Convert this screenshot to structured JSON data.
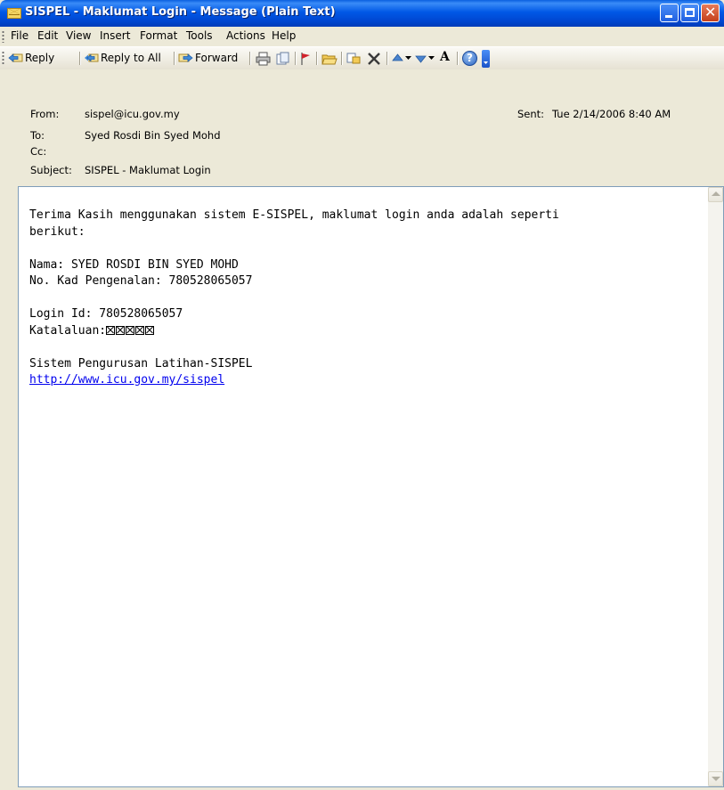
{
  "window": {
    "title": "SISPEL - Maklumat Login - Message (Plain Text)"
  },
  "menu": {
    "items": [
      "File",
      "Edit",
      "View",
      "Insert",
      "Format",
      "Tools",
      "Actions",
      "Help"
    ]
  },
  "toolbar": {
    "reply_label": "Reply",
    "reply_all_label": "Reply to All",
    "forward_label": "Forward",
    "font_size_glyph": "A",
    "help_glyph": "?"
  },
  "header": {
    "from_label": "From:",
    "from_value": "sispel@icu.gov.my",
    "sent_label": "Sent:",
    "sent_value": "Tue 2/14/2006 8:40 AM",
    "to_label": "To:",
    "to_value": "Syed Rosdi Bin Syed Mohd",
    "cc_label": "Cc:",
    "cc_value": "",
    "subject_label": "Subject:",
    "subject_value": "SISPEL - Maklumat Login"
  },
  "body": {
    "line1": "Terima Kasih menggunakan sistem E-SISPEL, maklumat login anda adalah seperti",
    "line2": "berikut:",
    "nama": "Nama: SYED ROSDI BIN SYED MOHD",
    "kad": "No. Kad Pengenalan: 780528065057",
    "login_id": "Login Id: 780528065057",
    "katalaluan_label": "Katalaluan:",
    "sistem": "Sistem Pengurusan Latihan-SISPEL",
    "link": "http://www.icu.gov.my/sispel"
  },
  "colors": {
    "titlebar": "#0058e6",
    "chrome": "#ece9d8",
    "link": "#0000ee",
    "close_button": "#c4401b"
  }
}
